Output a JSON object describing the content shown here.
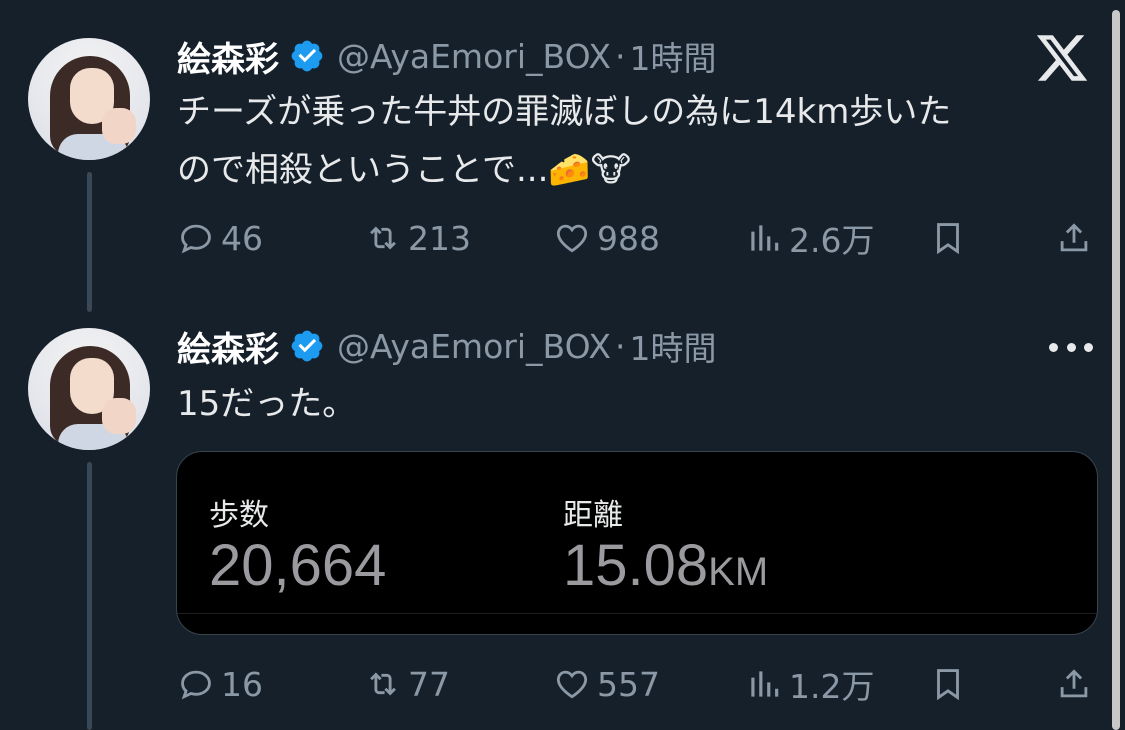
{
  "platform": {
    "logo_icon": "x-logo-icon"
  },
  "tweets": [
    {
      "display_name": "絵森彩",
      "handle": "@AyaEmori_BOX",
      "separator": "·",
      "time": "1時間",
      "text_line1": "チーズが乗った牛丼の罪滅ぼしの為に14km歩いた",
      "text_line2": "ので相殺ということで...🧀🐮",
      "replies": "46",
      "retweets": "213",
      "likes": "988",
      "views": "2.6万"
    },
    {
      "display_name": "絵森彩",
      "handle": "@AyaEmori_BOX",
      "separator": "·",
      "time": "1時間",
      "text_line1": "15だった。",
      "card": {
        "steps_label": "歩数",
        "steps_value": "20,664",
        "distance_label": "距離",
        "distance_value": "15.08",
        "distance_unit": "KM"
      },
      "replies": "16",
      "retweets": "77",
      "likes": "557",
      "views": "1.2万"
    }
  ],
  "colors": {
    "background": "#15202b",
    "verified": "#1d9bf0",
    "secondary_text": "#8b98a5"
  }
}
